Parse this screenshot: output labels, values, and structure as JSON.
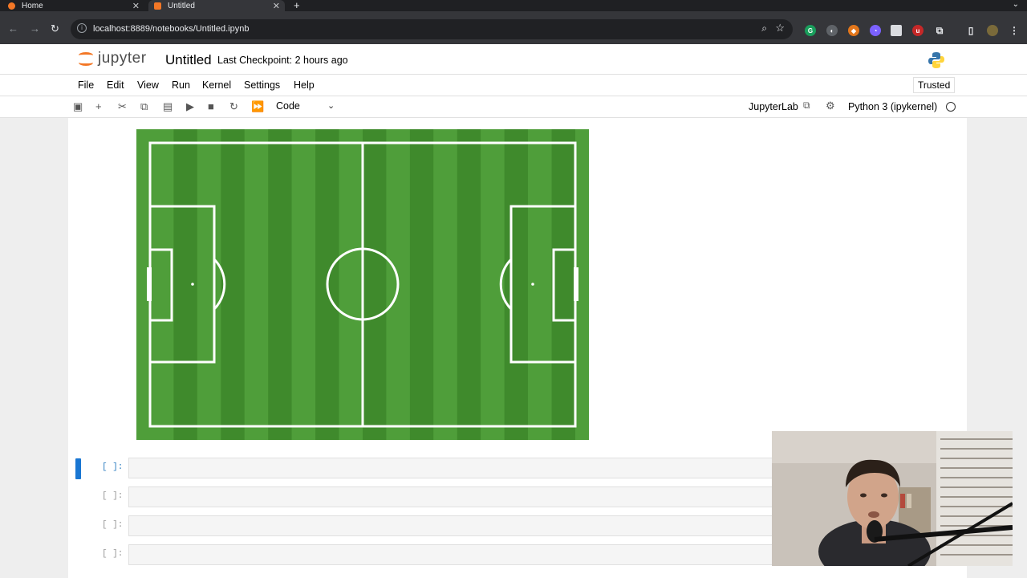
{
  "browser": {
    "tabs": [
      {
        "label": "Home"
      },
      {
        "label": "Untitled"
      }
    ],
    "url": "localhost:8889/notebooks/Untitled.ipynb"
  },
  "jupyter": {
    "logo_text": "jupyter",
    "notebook_title": "Untitled",
    "checkpoint": "Last Checkpoint: 2 hours ago",
    "menu": [
      "File",
      "Edit",
      "View",
      "Run",
      "Kernel",
      "Settings",
      "Help"
    ],
    "trusted": "Trusted",
    "cell_type": "Code",
    "jupyterlab_link": "JupyterLab",
    "kernel_name": "Python 3 (ipykernel)"
  },
  "cells": [
    {
      "prompt": "[ ]:",
      "active": true
    },
    {
      "prompt": "[ ]:",
      "active": false
    },
    {
      "prompt": "[ ]:",
      "active": false
    },
    {
      "prompt": "[ ]:",
      "active": false
    }
  ],
  "colors": {
    "pitch_green_dark": "#3f8a2c",
    "pitch_green_light": "#4f9e3a",
    "jupyter_orange": "#f37726",
    "active_cell": "#1976d2"
  }
}
